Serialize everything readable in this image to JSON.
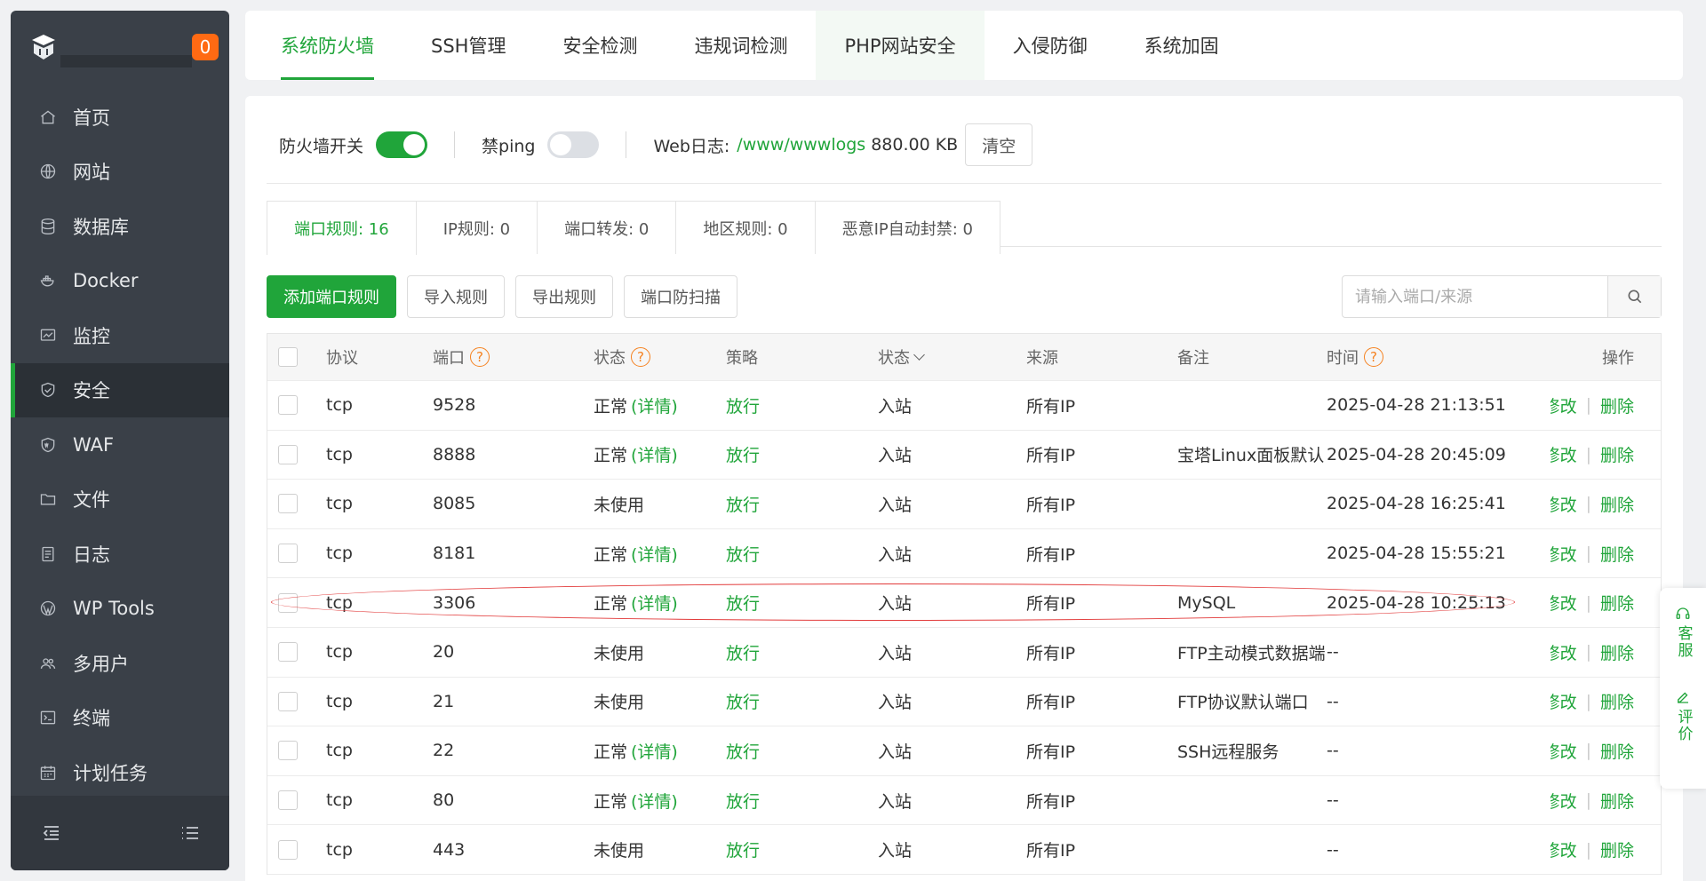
{
  "sidebar": {
    "notification_count": "0",
    "items": [
      {
        "label": "首页",
        "icon": "home-icon"
      },
      {
        "label": "网站",
        "icon": "globe-icon"
      },
      {
        "label": "数据库",
        "icon": "database-icon"
      },
      {
        "label": "Docker",
        "icon": "docker-icon"
      },
      {
        "label": "监控",
        "icon": "monitor-icon"
      },
      {
        "label": "安全",
        "icon": "shield-icon",
        "active": true
      },
      {
        "label": "WAF",
        "icon": "waf-shield-icon"
      },
      {
        "label": "文件",
        "icon": "folder-icon"
      },
      {
        "label": "日志",
        "icon": "log-icon"
      },
      {
        "label": "WP Tools",
        "icon": "wordpress-icon"
      },
      {
        "label": "多用户",
        "icon": "users-icon"
      },
      {
        "label": "终端",
        "icon": "terminal-icon"
      },
      {
        "label": "计划任务",
        "icon": "calendar-icon"
      }
    ]
  },
  "top_tabs": [
    {
      "label": "系统防火墙",
      "active": true
    },
    {
      "label": "SSH管理"
    },
    {
      "label": "安全检测"
    },
    {
      "label": "违规词检测"
    },
    {
      "label": "PHP网站安全",
      "hover": true
    },
    {
      "label": "入侵防御"
    },
    {
      "label": "系统加固"
    }
  ],
  "toolbar": {
    "firewall_label": "防火墙开关",
    "firewall_on": true,
    "ping_label": "禁ping",
    "ping_on": false,
    "weblog_label": "Web日志:",
    "weblog_path": "/www/wwwlogs",
    "weblog_size": "880.00 KB",
    "clear_label": "清空"
  },
  "sub_tabs": [
    {
      "label": "端口规则:  16",
      "active": true
    },
    {
      "label": "IP规则:  0"
    },
    {
      "label": "端口转发:  0"
    },
    {
      "label": "地区规则:  0"
    },
    {
      "label": "恶意IP自动封禁:  0"
    }
  ],
  "actions": {
    "add": "添加端口规则",
    "import": "导入规则",
    "export": "导出规则",
    "scan": "端口防扫描"
  },
  "search": {
    "placeholder": "请输入端口/来源",
    "value": ""
  },
  "table": {
    "headers": {
      "protocol": "协议",
      "port": "端口",
      "status": "状态",
      "policy": "策略",
      "direction": "状态",
      "source": "来源",
      "note": "备注",
      "time": "时间",
      "operation": "操作"
    },
    "edit_label": "修改",
    "delete_label": "删除",
    "rows": [
      {
        "protocol": "tcp",
        "port": "9528",
        "status": "正常",
        "detail": "(详情)",
        "policy": "放行",
        "direction": "入站",
        "source": "所有IP",
        "note": "",
        "time": "2025-04-28 21:13:51"
      },
      {
        "protocol": "tcp",
        "port": "8888",
        "status": "正常",
        "detail": "(详情)",
        "policy": "放行",
        "direction": "入站",
        "source": "所有IP",
        "note": "宝塔Linux面板默认",
        "time": "2025-04-28 20:45:09"
      },
      {
        "protocol": "tcp",
        "port": "8085",
        "status": "未使用",
        "detail": "",
        "policy": "放行",
        "direction": "入站",
        "source": "所有IP",
        "note": "",
        "time": "2025-04-28 16:25:41"
      },
      {
        "protocol": "tcp",
        "port": "8181",
        "status": "正常",
        "detail": "(详情)",
        "policy": "放行",
        "direction": "入站",
        "source": "所有IP",
        "note": "",
        "time": "2025-04-28 15:55:21"
      },
      {
        "protocol": "tcp",
        "port": "3306",
        "status": "正常",
        "detail": "(详情)",
        "policy": "放行",
        "direction": "入站",
        "source": "所有IP",
        "note": "MySQL",
        "time": "2025-04-28 10:25:13",
        "highlighted": true
      },
      {
        "protocol": "tcp",
        "port": "20",
        "status": "未使用",
        "detail": "",
        "policy": "放行",
        "direction": "入站",
        "source": "所有IP",
        "note": "FTP主动模式数据端",
        "time": "--"
      },
      {
        "protocol": "tcp",
        "port": "21",
        "status": "未使用",
        "detail": "",
        "policy": "放行",
        "direction": "入站",
        "source": "所有IP",
        "note": "FTP协议默认端口",
        "time": "--"
      },
      {
        "protocol": "tcp",
        "port": "22",
        "status": "正常",
        "detail": "(详情)",
        "policy": "放行",
        "direction": "入站",
        "source": "所有IP",
        "note": "SSH远程服务",
        "time": "--"
      },
      {
        "protocol": "tcp",
        "port": "80",
        "status": "正常",
        "detail": "(详情)",
        "policy": "放行",
        "direction": "入站",
        "source": "所有IP",
        "note": "",
        "time": "--"
      },
      {
        "protocol": "tcp",
        "port": "443",
        "status": "未使用",
        "detail": "",
        "policy": "放行",
        "direction": "入站",
        "source": "所有IP",
        "note": "",
        "time": "--"
      }
    ]
  },
  "float_widget": {
    "service": "客服",
    "review": "评价"
  },
  "colors": {
    "accent": "#20a53a",
    "warning": "#f58220",
    "sidebar_bg": "#3a4048",
    "badge": "#ff6a13",
    "highlight": "#e23b3b"
  }
}
